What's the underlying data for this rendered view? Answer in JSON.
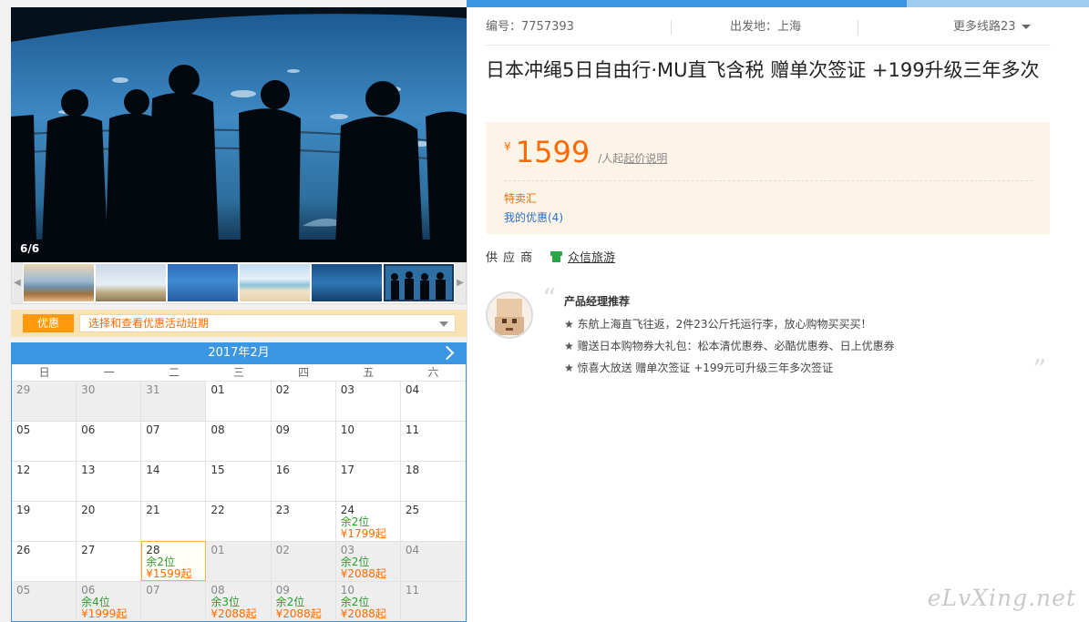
{
  "gallery": {
    "counter": "6/6"
  },
  "promo": {
    "tag": "优惠",
    "select_text": "选择和查看优惠活动班期"
  },
  "calendar": {
    "month": "2017年2月",
    "weekdays": [
      "日",
      "一",
      "二",
      "三",
      "四",
      "五",
      "六"
    ],
    "weeks": [
      [
        {
          "day": "29",
          "other": true
        },
        {
          "day": "30",
          "other": true
        },
        {
          "day": "31",
          "other": true
        },
        {
          "day": "01"
        },
        {
          "day": "02"
        },
        {
          "day": "03"
        },
        {
          "day": "04"
        }
      ],
      [
        {
          "day": "05"
        },
        {
          "day": "06"
        },
        {
          "day": "07"
        },
        {
          "day": "08"
        },
        {
          "day": "09"
        },
        {
          "day": "10"
        },
        {
          "day": "11"
        }
      ],
      [
        {
          "day": "12"
        },
        {
          "day": "13"
        },
        {
          "day": "14"
        },
        {
          "day": "15"
        },
        {
          "day": "16"
        },
        {
          "day": "17"
        },
        {
          "day": "18"
        }
      ],
      [
        {
          "day": "19"
        },
        {
          "day": "20"
        },
        {
          "day": "21"
        },
        {
          "day": "22"
        },
        {
          "day": "23"
        },
        {
          "day": "24",
          "seat": "余2位",
          "price": "¥1799起"
        },
        {
          "day": "25"
        }
      ],
      [
        {
          "day": "26"
        },
        {
          "day": "27"
        },
        {
          "day": "28",
          "seat": "余2位",
          "price": "¥1599起",
          "selected": true
        },
        {
          "day": "01",
          "other": true
        },
        {
          "day": "02",
          "other": true
        },
        {
          "day": "03",
          "other": true,
          "seat": "余2位",
          "price": "¥2088起"
        },
        {
          "day": "04",
          "other": true
        }
      ],
      [
        {
          "day": "05",
          "other": true
        },
        {
          "day": "06",
          "other": true,
          "seat": "余4位",
          "price": "¥1999起"
        },
        {
          "day": "07",
          "other": true
        },
        {
          "day": "08",
          "other": true,
          "seat": "余3位",
          "price": "¥2088起"
        },
        {
          "day": "09",
          "other": true,
          "seat": "余2位",
          "price": "¥2088起"
        },
        {
          "day": "10",
          "other": true,
          "seat": "余2位",
          "price": "¥2088起"
        },
        {
          "day": "11",
          "other": true
        }
      ]
    ]
  },
  "meta": {
    "code": "编号：7757393",
    "departure": "出发地：上海",
    "more_routes": "更多线路23"
  },
  "product": {
    "title": "日本冲绳5日自由行·MU直飞含税 赠单次签证 +199升级三年多次"
  },
  "price": {
    "currency": "¥",
    "amount": "1599",
    "unit": "/人起",
    "explain": "起价说明",
    "deal": "特卖汇",
    "coupon": "我的优惠(4)"
  },
  "supplier": {
    "label": "供应商",
    "name": "众信旅游"
  },
  "manager": {
    "title": "产品经理推荐",
    "points": [
      "东航上海直飞往返，2件23公斤托运行李，放心购物买买买！",
      "赠送日本购物券大礼包：松本清优惠券、必酷优惠券、日上优惠券",
      "惊喜大放送 赠单次签证 +199元可升级三年多次签证"
    ]
  },
  "watermark": "eLvXing.net",
  "colors": {
    "accent_blue": "#3b97e3",
    "price_orange": "#ff6a00",
    "seat_green": "#2e9a2e"
  }
}
